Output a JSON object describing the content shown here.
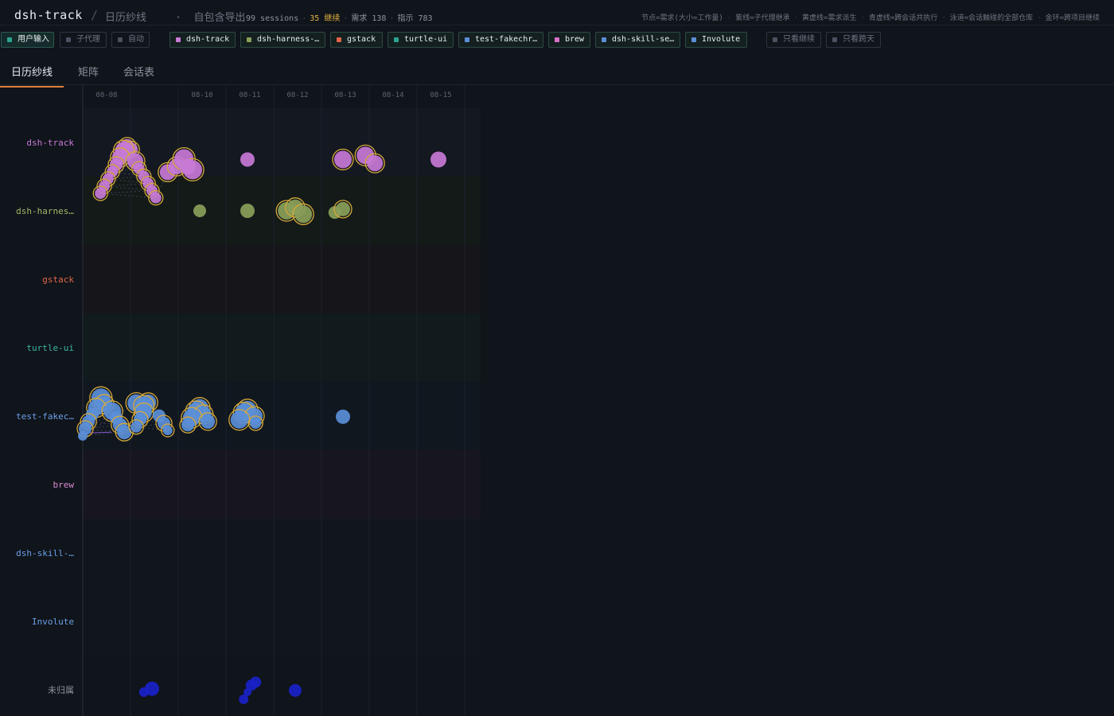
{
  "header": {
    "app_title": "dsh-track",
    "separator": "/",
    "view_name": "日历纱线",
    "middle_dot": "·",
    "export_label": "自包含导出",
    "sessions": "99 sessions",
    "dot": "·",
    "continuations": "35 继续",
    "requirements": "需求 138",
    "instructions": "指示 783",
    "legend": [
      "节点=需求(大小=工作量)",
      "紫线=子代理继承",
      "黄虚线=需求派生",
      "青虚线=跨会话共执行",
      "泳道=会话触碰的全部仓库",
      "金环=跨项目继续"
    ]
  },
  "filters": {
    "source": [
      {
        "label": "用户输入",
        "active": true,
        "color": "#2aa58f"
      },
      {
        "label": "子代理",
        "active": false,
        "color": "#4a5260"
      },
      {
        "label": "自动",
        "active": false,
        "color": "#4a5260"
      }
    ],
    "projects": [
      {
        "label": "dsh-track",
        "color": "#c77ad6"
      },
      {
        "label": "dsh-harness-…",
        "color": "#8aa05a"
      },
      {
        "label": "gstack",
        "color": "#e0654a"
      },
      {
        "label": "turtle-ui",
        "color": "#2aa58f"
      },
      {
        "label": "test-fakechr…",
        "color": "#5b8fd8"
      },
      {
        "label": "brew",
        "color": "#d870c8"
      },
      {
        "label": "dsh-skill-se…",
        "color": "#5b8fd8"
      },
      {
        "label": "Involute",
        "color": "#5b8fd8"
      }
    ],
    "toggles": [
      {
        "label": "只看继续"
      },
      {
        "label": "只看跨天"
      }
    ]
  },
  "tabs": [
    {
      "label": "日历纱线",
      "active": true
    },
    {
      "label": "矩阵",
      "active": false
    },
    {
      "label": "会话表",
      "active": false
    }
  ],
  "colors": {
    "ring": "#d6a93a",
    "accent": "#e0823d"
  },
  "chart_data": {
    "type": "scatter",
    "x_ticks": [
      "08-08",
      "08-10",
      "08-11",
      "08-12",
      "08-13",
      "08-14",
      "08-15"
    ],
    "lanes": [
      {
        "name": "dsh-track",
        "color": "#c77ad6",
        "label_color": "#c77ad6",
        "bg": "#141820"
      },
      {
        "name": "dsh-harnes…",
        "color": "#8aa05a",
        "label_color": "#a4b86a",
        "bg": "#141a18"
      },
      {
        "name": "gstack",
        "color": "#e0654a",
        "label_color": "#e0654a",
        "bg": "#16161a"
      },
      {
        "name": "turtle-ui",
        "color": "#2aa58f",
        "label_color": "#3bb6a0",
        "bg": "#111a1d"
      },
      {
        "name": "test-fakec…",
        "color": "#5b8fd8",
        "label_color": "#6aa0e6",
        "bg": "#11171f"
      },
      {
        "name": "brew",
        "color": "#d870c8",
        "label_color": "#d88ad0",
        "bg": "#17161e"
      },
      {
        "name": "dsh-skill-…",
        "color": "#5b8fd8",
        "label_color": "#6aa0e6",
        "bg": "#11161e"
      },
      {
        "name": "Involute",
        "color": "#5b8fd8",
        "label_color": "#6aa0e6",
        "bg": "#11161e"
      },
      {
        "name": "未归属",
        "color": "#1a22c8",
        "label_color": "#8b949e",
        "bg": "#10141b"
      }
    ],
    "nodes": [
      {
        "lane": 0,
        "day": 0.93,
        "pos": 0.11,
        "size": 9,
        "ring": true
      },
      {
        "lane": 0,
        "day": 1.02,
        "pos": 0.2,
        "size": 8,
        "ring": true
      },
      {
        "lane": 0,
        "day": 0.86,
        "pos": 0.24,
        "size": 11,
        "ring": true
      },
      {
        "lane": 0,
        "day": 0.78,
        "pos": 0.44,
        "size": 10,
        "ring": true
      },
      {
        "lane": 0,
        "day": 1.1,
        "pos": 0.55,
        "size": 10,
        "ring": true
      },
      {
        "lane": 0,
        "day": 0.7,
        "pos": 0.65,
        "size": 8,
        "ring": true
      },
      {
        "lane": 0,
        "day": 1.18,
        "pos": 0.77,
        "size": 7,
        "ring": true
      },
      {
        "lane": 0,
        "day": 0.62,
        "pos": 0.86,
        "size": 7,
        "ring": true
      },
      {
        "lane": 0,
        "day": 1.28,
        "pos": 0.99,
        "size": 7,
        "ring": true
      },
      {
        "lane": 0,
        "day": 0.53,
        "pos": 1.07,
        "size": 7,
        "ring": true
      },
      {
        "lane": 0,
        "day": 1.37,
        "pos": 1.2,
        "size": 7,
        "ring": true
      },
      {
        "lane": 0,
        "day": 0.45,
        "pos": 1.28,
        "size": 7,
        "ring": true
      },
      {
        "lane": 0,
        "day": 1.45,
        "pos": 1.41,
        "size": 7,
        "ring": true
      },
      {
        "lane": 0,
        "day": 0.37,
        "pos": 1.49,
        "size": 7,
        "ring": true
      },
      {
        "lane": 0,
        "day": 1.53,
        "pos": 1.62,
        "size": 7,
        "ring": true
      },
      {
        "lane": 0,
        "day": 1.78,
        "pos": 0.87,
        "size": 10,
        "ring": true
      },
      {
        "lane": 0,
        "day": 1.97,
        "pos": 0.7,
        "size": 10,
        "ring": true
      },
      {
        "lane": 0,
        "day": 2.12,
        "pos": 0.48,
        "size": 12,
        "ring": true
      },
      {
        "lane": 0,
        "day": 2.3,
        "pos": 0.8,
        "size": 12,
        "ring": true
      },
      {
        "lane": 0,
        "day": 2.2,
        "pos": 0.71,
        "size": 10,
        "ring": false
      },
      {
        "lane": 0,
        "day": 3.45,
        "pos": 0.5,
        "size": 9,
        "ring": false
      },
      {
        "lane": 0,
        "day": 5.45,
        "pos": 0.5,
        "size": 11,
        "ring": true
      },
      {
        "lane": 0,
        "day": 5.92,
        "pos": 0.38,
        "size": 11,
        "ring": true
      },
      {
        "lane": 0,
        "day": 6.12,
        "pos": 0.61,
        "size": 10,
        "ring": true
      },
      {
        "lane": 0,
        "day": 7.45,
        "pos": 0.5,
        "size": 10,
        "ring": false
      },
      {
        "lane": 1,
        "day": 2.45,
        "pos": 0.0,
        "size": 8,
        "ring": false
      },
      {
        "lane": 1,
        "day": 3.45,
        "pos": 0.0,
        "size": 9,
        "ring": false
      },
      {
        "lane": 1,
        "day": 4.27,
        "pos": 0.0,
        "size": 11,
        "ring": true
      },
      {
        "lane": 1,
        "day": 4.45,
        "pos": -0.1,
        "size": 10,
        "ring": true
      },
      {
        "lane": 1,
        "day": 4.62,
        "pos": 0.1,
        "size": 11,
        "ring": true
      },
      {
        "lane": 1,
        "day": 5.28,
        "pos": 0.05,
        "size": 8,
        "ring": false
      },
      {
        "lane": 1,
        "day": 5.45,
        "pos": -0.05,
        "size": 9,
        "ring": true
      },
      {
        "lane": 4,
        "day": 0.38,
        "pos": -0.53,
        "size": 12,
        "ring": true
      },
      {
        "lane": 4,
        "day": 0.45,
        "pos": -0.35,
        "size": 10,
        "ring": true
      },
      {
        "lane": 4,
        "day": 0.28,
        "pos": -0.24,
        "size": 10,
        "ring": true
      },
      {
        "lane": 4,
        "day": 0.62,
        "pos": -0.14,
        "size": 11,
        "ring": true
      },
      {
        "lane": 4,
        "day": 0.2,
        "pos": -0.05,
        "size": 8,
        "ring": false
      },
      {
        "lane": 4,
        "day": 0.7,
        "pos": 0.05,
        "size": 8,
        "ring": false
      },
      {
        "lane": 4,
        "day": 0.12,
        "pos": 0.16,
        "size": 8,
        "ring": true
      },
      {
        "lane": 4,
        "day": 0.78,
        "pos": 0.26,
        "size": 9,
        "ring": true
      },
      {
        "lane": 4,
        "day": 0.05,
        "pos": 0.37,
        "size": 8,
        "ring": true
      },
      {
        "lane": 4,
        "day": 0.87,
        "pos": 0.47,
        "size": 9,
        "ring": true
      },
      {
        "lane": 4,
        "day": 0.0,
        "pos": 0.58,
        "size": 6,
        "ring": false
      },
      {
        "lane": 4,
        "day": 1.12,
        "pos": -0.38,
        "size": 11,
        "ring": true
      },
      {
        "lane": 4,
        "day": 1.37,
        "pos": -0.4,
        "size": 10,
        "ring": true
      },
      {
        "lane": 4,
        "day": 1.28,
        "pos": -0.3,
        "size": 11,
        "ring": true
      },
      {
        "lane": 4,
        "day": 1.28,
        "pos": -0.15,
        "size": 8,
        "ring": false
      },
      {
        "lane": 4,
        "day": 1.28,
        "pos": -0.1,
        "size": 10,
        "ring": true
      },
      {
        "lane": 4,
        "day": 1.6,
        "pos": -0.01,
        "size": 8,
        "ring": false
      },
      {
        "lane": 4,
        "day": 1.2,
        "pos": 0.1,
        "size": 8,
        "ring": true
      },
      {
        "lane": 4,
        "day": 1.7,
        "pos": 0.21,
        "size": 8,
        "ring": true
      },
      {
        "lane": 4,
        "day": 1.12,
        "pos": 0.32,
        "size": 7,
        "ring": true
      },
      {
        "lane": 4,
        "day": 1.78,
        "pos": 0.42,
        "size": 6,
        "ring": true
      },
      {
        "lane": 4,
        "day": 2.45,
        "pos": -0.24,
        "size": 11,
        "ring": true
      },
      {
        "lane": 4,
        "day": 2.37,
        "pos": -0.14,
        "size": 11,
        "ring": true
      },
      {
        "lane": 4,
        "day": 2.53,
        "pos": -0.05,
        "size": 10,
        "ring": true
      },
      {
        "lane": 4,
        "day": 2.28,
        "pos": 0.05,
        "size": 11,
        "ring": true
      },
      {
        "lane": 4,
        "day": 2.62,
        "pos": 0.16,
        "size": 9,
        "ring": true
      },
      {
        "lane": 4,
        "day": 2.2,
        "pos": 0.26,
        "size": 8,
        "ring": true
      },
      {
        "lane": 4,
        "day": 3.45,
        "pos": -0.19,
        "size": 11,
        "ring": true
      },
      {
        "lane": 4,
        "day": 3.37,
        "pos": -0.1,
        "size": 11,
        "ring": true
      },
      {
        "lane": 4,
        "day": 3.6,
        "pos": 0.0,
        "size": 10,
        "ring": true
      },
      {
        "lane": 4,
        "day": 3.28,
        "pos": 0.11,
        "size": 11,
        "ring": true
      },
      {
        "lane": 4,
        "day": 3.62,
        "pos": 0.21,
        "size": 7,
        "ring": true
      },
      {
        "lane": 4,
        "day": 5.45,
        "pos": 0.02,
        "size": 9,
        "ring": false
      },
      {
        "lane": 8,
        "day": 1.45,
        "pos": -0.03,
        "size": 9,
        "ring": false
      },
      {
        "lane": 8,
        "day": 1.28,
        "pos": 0.07,
        "size": 6,
        "ring": false
      },
      {
        "lane": 8,
        "day": 3.62,
        "pos": -0.22,
        "size": 7,
        "ring": false
      },
      {
        "lane": 8,
        "day": 3.53,
        "pos": -0.13,
        "size": 7,
        "ring": false
      },
      {
        "lane": 8,
        "day": 3.45,
        "pos": 0.07,
        "size": 5,
        "ring": false
      },
      {
        "lane": 8,
        "day": 3.37,
        "pos": 0.28,
        "size": 6,
        "ring": false
      },
      {
        "lane": 8,
        "day": 4.45,
        "pos": 0.02,
        "size": 8,
        "ring": false
      }
    ]
  }
}
